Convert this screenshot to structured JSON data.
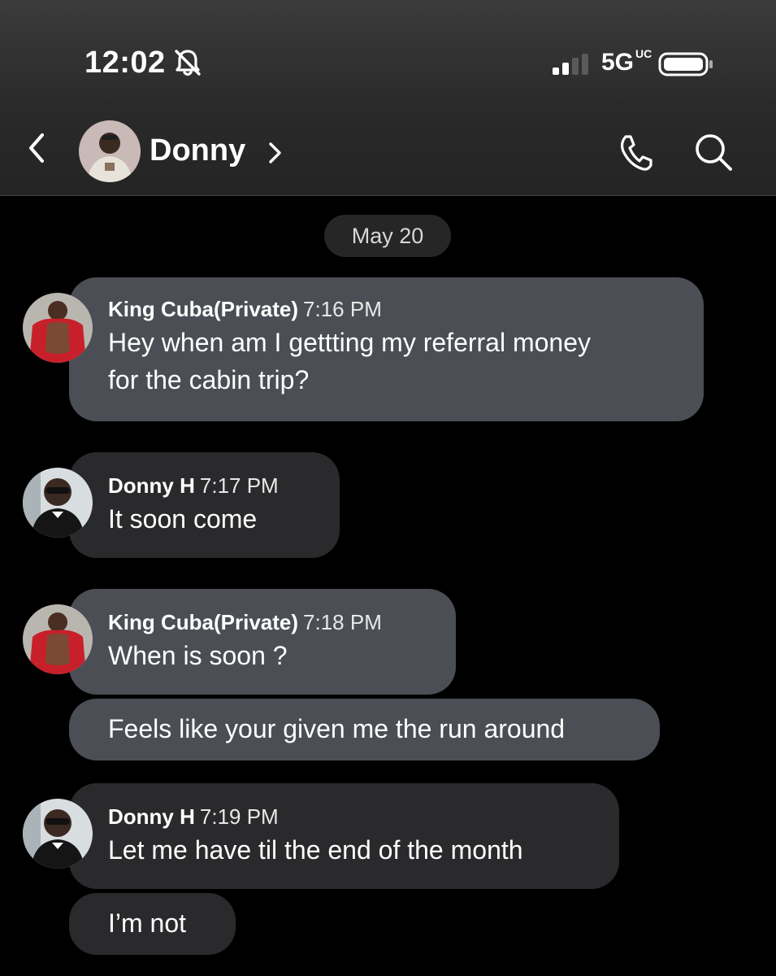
{
  "status_bar": {
    "time": "12:02",
    "network": "5G",
    "network_badge": "UC",
    "silent": true
  },
  "header": {
    "contact_name": "Donny"
  },
  "date_separator": "May 20",
  "messages": [
    {
      "sender": "King Cuba(Private)",
      "time": "7:16 PM",
      "lines": [
        "Hey when am I gettting my referral money",
        "for the cabin trip?"
      ]
    },
    {
      "sender": "Donny H",
      "time": "7:17 PM",
      "lines": [
        "It soon come"
      ]
    },
    {
      "sender": "King Cuba(Private)",
      "time": "7:18 PM",
      "lines": [
        "When is soon ?"
      ],
      "followup": "Feels like your given me the run around"
    },
    {
      "sender": "Donny H",
      "time": "7:19 PM",
      "lines": [
        "Let me have til the end of the month"
      ],
      "followup": "I’m not"
    }
  ],
  "colors": {
    "background": "#000000",
    "incoming_bubble_light": "#4b4e55",
    "incoming_bubble_dark": "#2a2a2c",
    "accent_red": "#c8202a"
  }
}
